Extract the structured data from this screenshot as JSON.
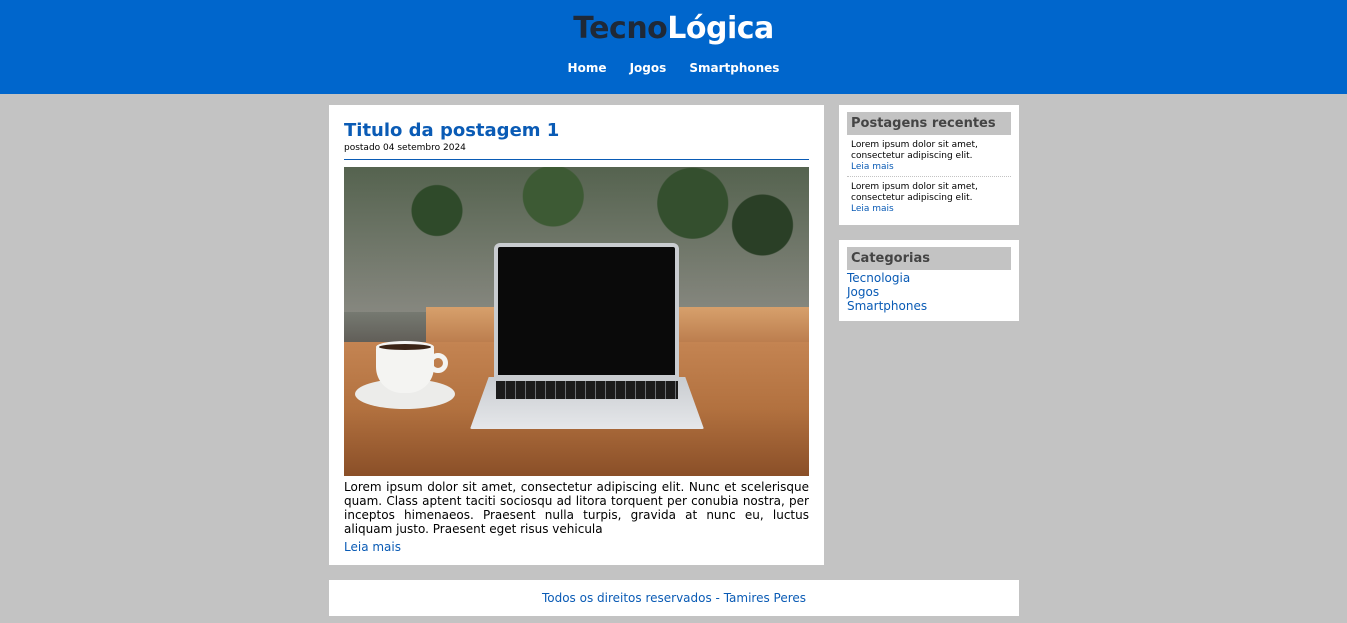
{
  "header": {
    "logo_part1": "Tecno",
    "logo_part2": "Lógica",
    "nav": [
      "Home",
      "Jogos",
      "Smartphones"
    ]
  },
  "post": {
    "title": "Titulo da postagem 1",
    "date": "postado 04 setembro 2024",
    "text": "Lorem ipsum dolor sit amet, consectetur adipiscing elit. Nunc et scelerisque quam. Class aptent taciti sociosqu ad litora torquent per conubia nostra, per inceptos himenaeos. Praesent nulla turpis, gravida at nunc eu, luctus aliquam justo. Praesent eget risus vehicula",
    "read_more": "Leia mais"
  },
  "recent": {
    "title": "Postagens recentes",
    "items": [
      {
        "text": "Lorem ipsum dolor sit amet, consectetur adipiscing elit.",
        "link": "Leia mais"
      },
      {
        "text": "Lorem ipsum dolor sit amet, consectetur adipiscing elit.",
        "link": "Leia mais"
      }
    ]
  },
  "categories": {
    "title": "Categorias",
    "items": [
      "Tecnologia",
      "Jogos",
      "Smartphones"
    ]
  },
  "footer": {
    "text": "Todos os direitos reservados - Tamires Peres"
  },
  "colors": {
    "header_bg": "#0066cc",
    "page_bg": "#c3c3c3",
    "link": "#0a5bb5"
  }
}
